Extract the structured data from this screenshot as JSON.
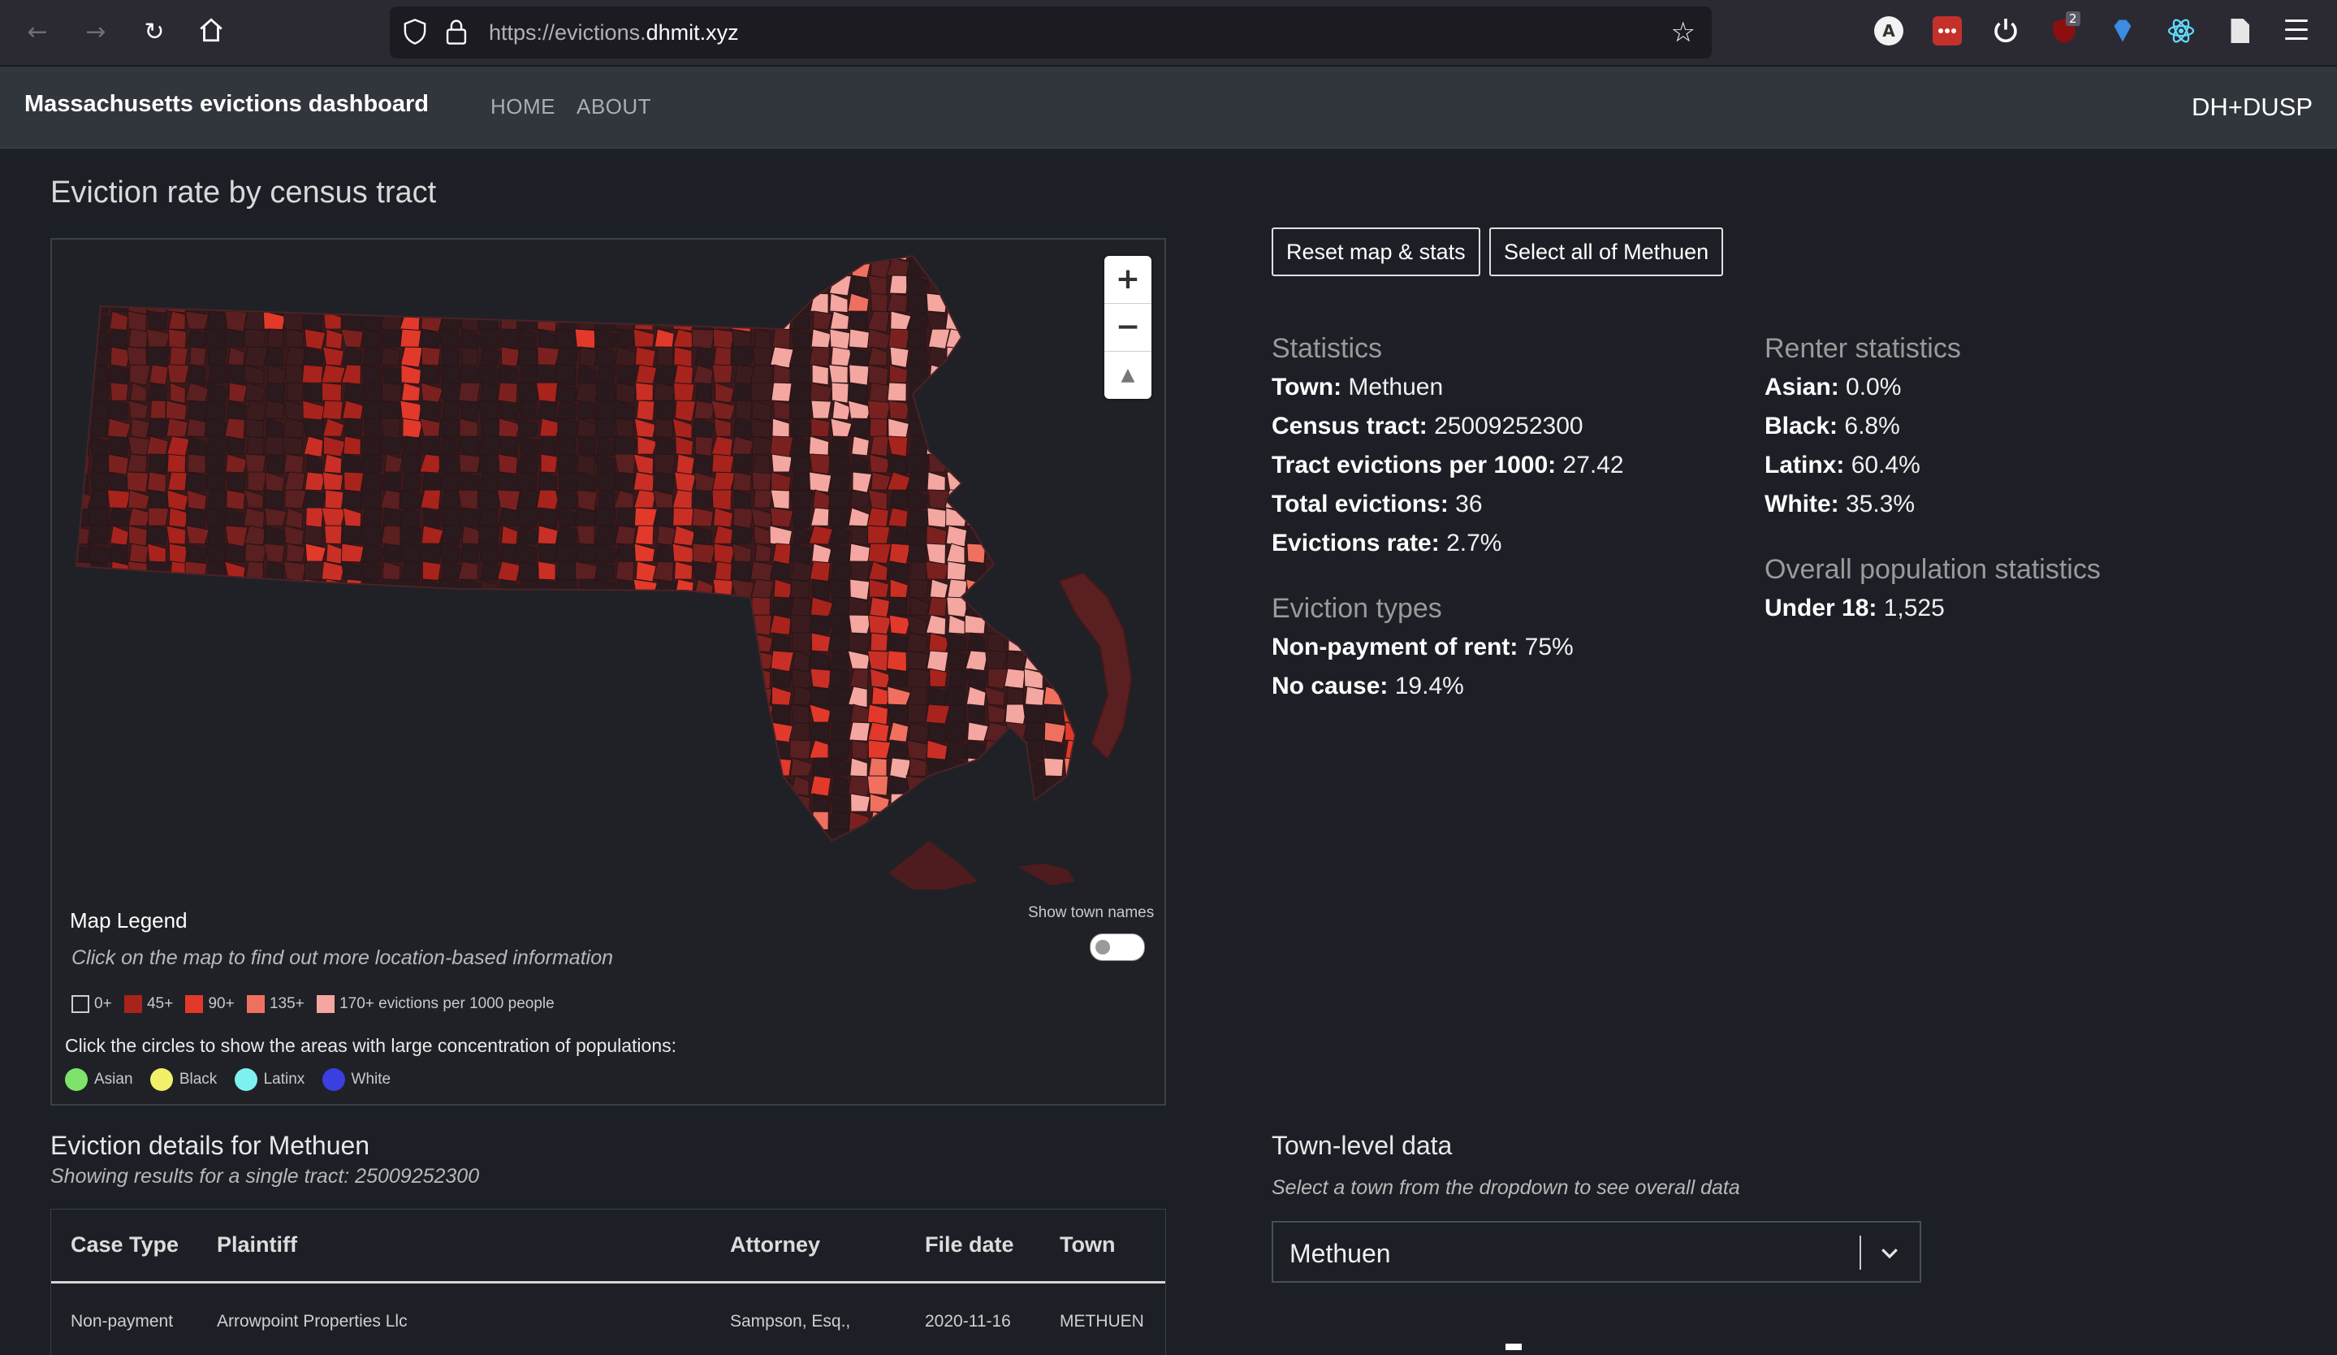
{
  "browser": {
    "url_prefix": "https://evictions.",
    "url_host": "dhmit.xyz",
    "ext_badge": "2",
    "ext_profile": "A"
  },
  "nav": {
    "brand": "Massachusetts evictions dashboard",
    "links": [
      "HOME",
      "ABOUT"
    ],
    "right": "DH+DUSP"
  },
  "map": {
    "title": "Eviction rate by census tract",
    "legend_title": "Map Legend",
    "legend_hint": "Click on the map to find out more location-based information",
    "legend_bins": [
      {
        "label": "0+",
        "color": "#1c1f25"
      },
      {
        "label": "45+",
        "color": "#a8231c"
      },
      {
        "label": "90+",
        "color": "#e2392b"
      },
      {
        "label": "135+",
        "color": "#f07060"
      },
      {
        "label": "170+ evictions per 1000 people",
        "color": "#f4a6a0"
      }
    ],
    "population_hint": "Click the circles to show the areas with large concentration of populations:",
    "populations": [
      {
        "label": "Asian",
        "color": "#7de36a"
      },
      {
        "label": "Black",
        "color": "#f2f06a"
      },
      {
        "label": "Latinx",
        "color": "#7ff0f0"
      },
      {
        "label": "White",
        "color": "#3a3fe0"
      }
    ],
    "toggle_label": "Show town names",
    "zoom_in": "+",
    "zoom_out": "−",
    "reset_north": "▲"
  },
  "buttons": {
    "reset": "Reset map & stats",
    "select_town": "Select all of Methuen"
  },
  "statistics": {
    "heading": "Statistics",
    "rows": [
      {
        "label": "Town:",
        "value": "Methuen"
      },
      {
        "label": "Census tract:",
        "value": "25009252300"
      },
      {
        "label": "Tract evictions per 1000:",
        "value": "27.42"
      },
      {
        "label": "Total evictions:",
        "value": "36"
      },
      {
        "label": "Evictions rate:",
        "value": "2.7%"
      }
    ]
  },
  "eviction_types": {
    "heading": "Eviction types",
    "rows": [
      {
        "label": "Non-payment of rent:",
        "value": "75%"
      },
      {
        "label": "No cause:",
        "value": "19.4%"
      }
    ]
  },
  "renter_statistics": {
    "heading": "Renter statistics",
    "rows": [
      {
        "label": "Asian:",
        "value": "0.0%"
      },
      {
        "label": "Black:",
        "value": "6.8%"
      },
      {
        "label": "Latinx:",
        "value": "60.4%"
      },
      {
        "label": "White:",
        "value": "35.3%"
      }
    ]
  },
  "population_statistics": {
    "heading": "Overall population statistics",
    "rows": [
      {
        "label": "Under 18:",
        "value": "1,525"
      }
    ]
  },
  "details": {
    "title": "Eviction details for Methuen",
    "subtitle": "Showing results for a single tract: 25009252300",
    "columns": [
      "Case Type",
      "Plaintiff",
      "Attorney",
      "File date",
      "Town"
    ],
    "rows": [
      [
        "Non-payment",
        "Arrowpoint Properties Llc",
        "Sampson, Esq.,",
        "2020-11-16",
        "METHUEN"
      ]
    ]
  },
  "town_data": {
    "title": "Town-level data",
    "subtitle": "Select a town from the dropdown to see overall data",
    "selected": "Methuen"
  }
}
